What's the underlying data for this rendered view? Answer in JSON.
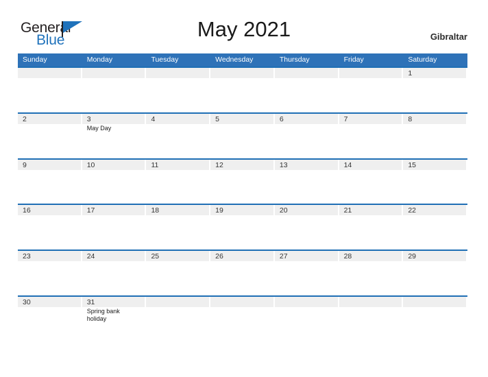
{
  "brand": {
    "name_part1": "General",
    "name_part2": "Blue",
    "flag_icon": "flag-icon"
  },
  "header": {
    "title": "May 2021",
    "region": "Gibraltar"
  },
  "colors": {
    "header_blue": "#2e72b8",
    "rule_blue": "#1f6fb5",
    "band_gray": "#efefef",
    "brand_blue": "#1f72bb"
  },
  "calendar": {
    "weekdays": [
      "Sunday",
      "Monday",
      "Tuesday",
      "Wednesday",
      "Thursday",
      "Friday",
      "Saturday"
    ],
    "weeks": [
      [
        {
          "date": "",
          "event": ""
        },
        {
          "date": "",
          "event": ""
        },
        {
          "date": "",
          "event": ""
        },
        {
          "date": "",
          "event": ""
        },
        {
          "date": "",
          "event": ""
        },
        {
          "date": "",
          "event": ""
        },
        {
          "date": "1",
          "event": ""
        }
      ],
      [
        {
          "date": "2",
          "event": ""
        },
        {
          "date": "3",
          "event": "May Day"
        },
        {
          "date": "4",
          "event": ""
        },
        {
          "date": "5",
          "event": ""
        },
        {
          "date": "6",
          "event": ""
        },
        {
          "date": "7",
          "event": ""
        },
        {
          "date": "8",
          "event": ""
        }
      ],
      [
        {
          "date": "9",
          "event": ""
        },
        {
          "date": "10",
          "event": ""
        },
        {
          "date": "11",
          "event": ""
        },
        {
          "date": "12",
          "event": ""
        },
        {
          "date": "13",
          "event": ""
        },
        {
          "date": "14",
          "event": ""
        },
        {
          "date": "15",
          "event": ""
        }
      ],
      [
        {
          "date": "16",
          "event": ""
        },
        {
          "date": "17",
          "event": ""
        },
        {
          "date": "18",
          "event": ""
        },
        {
          "date": "19",
          "event": ""
        },
        {
          "date": "20",
          "event": ""
        },
        {
          "date": "21",
          "event": ""
        },
        {
          "date": "22",
          "event": ""
        }
      ],
      [
        {
          "date": "23",
          "event": ""
        },
        {
          "date": "24",
          "event": ""
        },
        {
          "date": "25",
          "event": ""
        },
        {
          "date": "26",
          "event": ""
        },
        {
          "date": "27",
          "event": ""
        },
        {
          "date": "28",
          "event": ""
        },
        {
          "date": "29",
          "event": ""
        }
      ],
      [
        {
          "date": "30",
          "event": ""
        },
        {
          "date": "31",
          "event": "Spring bank holiday"
        },
        {
          "date": "",
          "event": ""
        },
        {
          "date": "",
          "event": ""
        },
        {
          "date": "",
          "event": ""
        },
        {
          "date": "",
          "event": ""
        },
        {
          "date": "",
          "event": ""
        }
      ]
    ]
  }
}
